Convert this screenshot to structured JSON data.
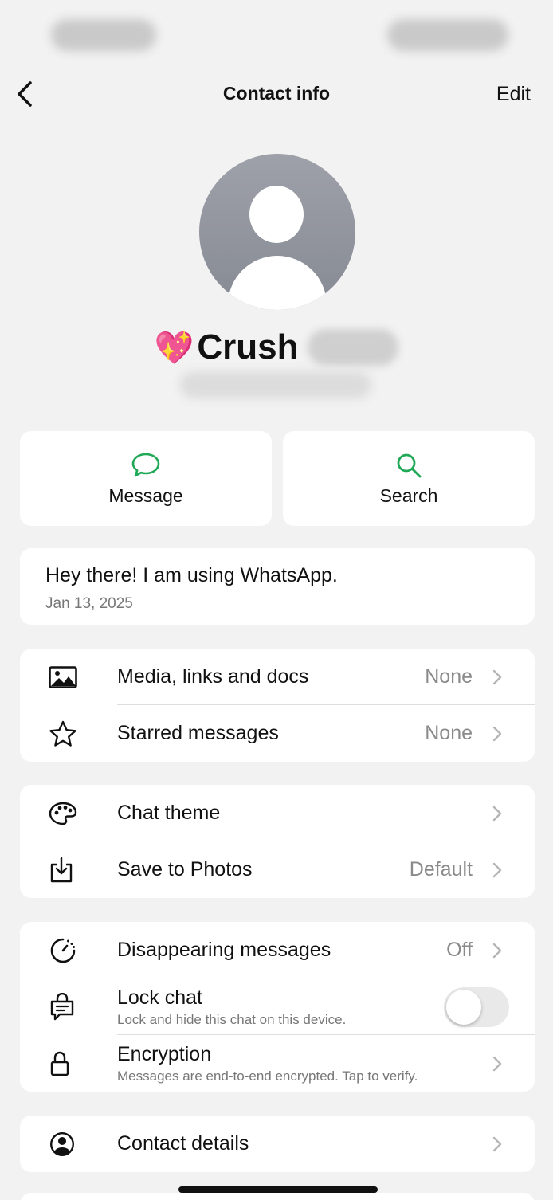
{
  "nav": {
    "title": "Contact info",
    "edit_label": "Edit"
  },
  "profile": {
    "emoji": "💖",
    "name": "Crush"
  },
  "actions": [
    {
      "label": "Message",
      "icon": "chat-bubble-icon"
    },
    {
      "label": "Search",
      "icon": "search-icon"
    }
  ],
  "about": {
    "status": "Hey there! I am using WhatsApp.",
    "date": "Jan 13, 2025"
  },
  "group1": [
    {
      "title": "Media, links and docs",
      "value": "None",
      "icon": "image-icon"
    },
    {
      "title": "Starred messages",
      "value": "None",
      "icon": "star-icon"
    }
  ],
  "group2": [
    {
      "title": "Chat theme",
      "value": "",
      "icon": "palette-icon"
    },
    {
      "title": "Save to Photos",
      "value": "Default",
      "icon": "save-download-icon"
    }
  ],
  "group3": [
    {
      "title": "Disappearing messages",
      "value": "Off",
      "icon": "timer-icon"
    },
    {
      "title": "Lock chat",
      "subtitle": "Lock and hide this chat on this device.",
      "toggle_on": false,
      "icon": "lock-chat-icon"
    },
    {
      "title": "Encryption",
      "subtitle": "Messages are end-to-end encrypted. Tap to verify.",
      "icon": "lock-icon"
    }
  ],
  "group4": [
    {
      "title": "Contact details",
      "icon": "person-circle-icon"
    }
  ],
  "colors": {
    "accent": "#1fa855",
    "background": "#f2f2f2",
    "card": "#ffffff",
    "secondary_text": "#8a8a8a"
  }
}
